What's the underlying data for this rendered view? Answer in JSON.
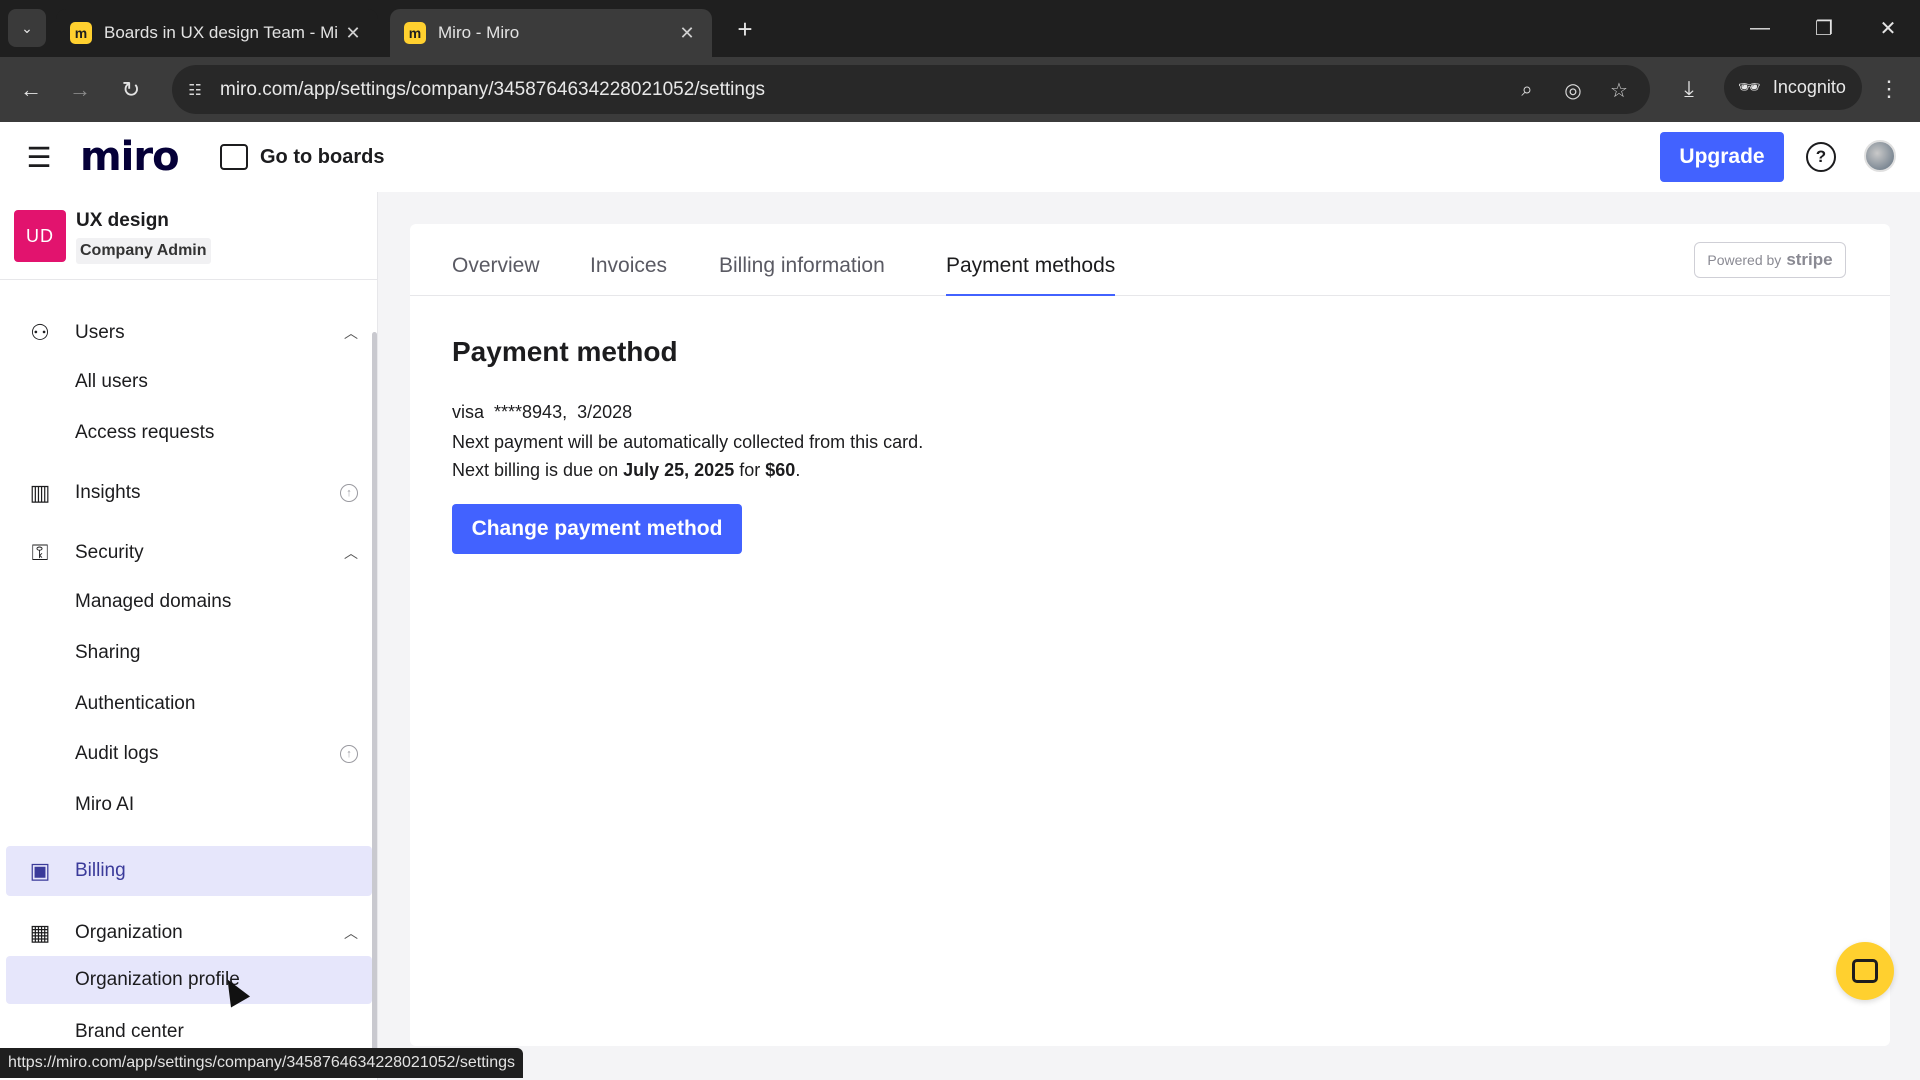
{
  "browser": {
    "tabs": [
      {
        "title": "Boards in UX design Team - Mi",
        "favicon": "miro-favicon",
        "active": false
      },
      {
        "title": "Miro - Miro",
        "favicon": "miro-favicon",
        "active": true
      }
    ],
    "url": "miro.com/app/settings/company/3458764634228021052/settings",
    "incognito_label": "Incognito",
    "status_url": "https://miro.com/app/settings/company/3458764634228021052/settings"
  },
  "header": {
    "logo": "miro",
    "go_to_boards": "Go to boards",
    "upgrade": "Upgrade",
    "help_icon": "help-circle-icon"
  },
  "sidebar": {
    "org_initials": "UD",
    "org_name": "UX design",
    "org_role": "Company Admin",
    "org_badge_color": "#e2136e",
    "sections": {
      "users": {
        "label": "Users",
        "children": [
          "All users",
          "Access requests"
        ]
      },
      "insights": {
        "label": "Insights"
      },
      "security": {
        "label": "Security",
        "children": [
          "Managed domains",
          "Sharing",
          "Authentication",
          "Audit logs",
          "Miro AI"
        ]
      },
      "billing": {
        "label": "Billing"
      },
      "organization": {
        "label": "Organization",
        "children": [
          "Organization profile",
          "Brand center"
        ]
      }
    }
  },
  "main": {
    "tabs": [
      "Overview",
      "Invoices",
      "Billing information",
      "Payment methods"
    ],
    "active_tab": "Payment methods",
    "powered_by": "Powered by",
    "stripe": "stripe",
    "heading": "Payment method",
    "card_brand": "visa",
    "card_number": "****8943,",
    "card_expiry": "3/2028",
    "collection_note": "Next payment will be automatically collected from this card.",
    "billing_prefix": "Next billing is due on",
    "billing_date": "July 25, 2025",
    "billing_for": "for",
    "billing_amount": "$60",
    "billing_suffix": ".",
    "change_button": "Change payment method"
  },
  "colors": {
    "accent": "#4262ff",
    "selected_bg": "#e6e6fb",
    "chat_fab": "#ffd02f"
  }
}
